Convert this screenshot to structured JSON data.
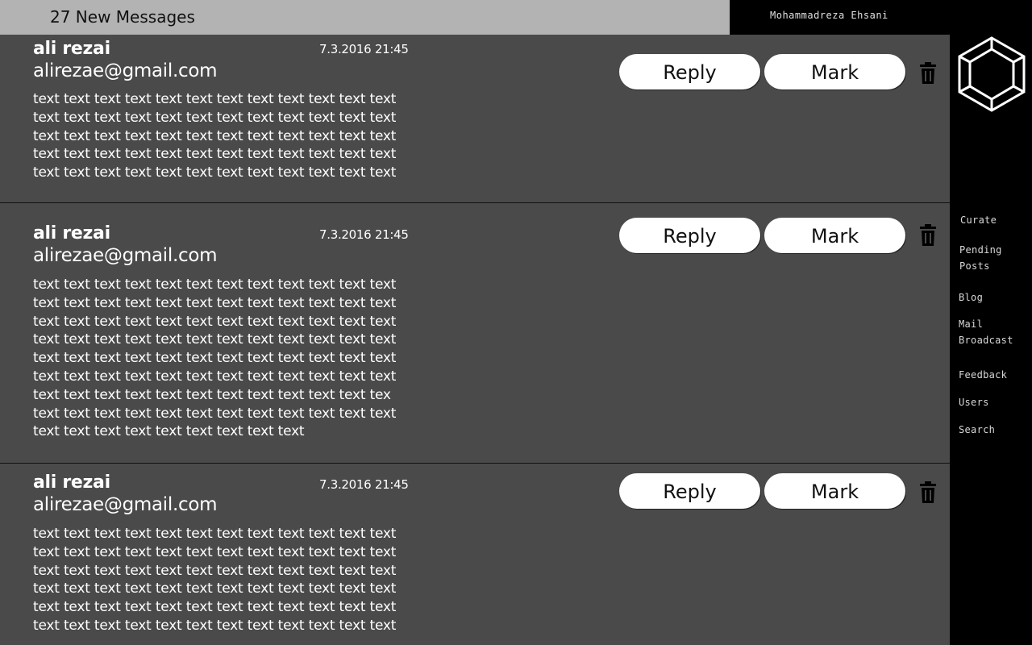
{
  "header": {
    "new_messages": "27 New Messages"
  },
  "user": {
    "name": "Mohammadreza Ehsani"
  },
  "sidebar": {
    "logo": "hexagon-cube-logo",
    "items": [
      {
        "label": "Curate"
      },
      {
        "label": "Pending\nPosts"
      },
      {
        "label": "Blog"
      },
      {
        "label": "Mail\nBroadcast"
      },
      {
        "label": "Feedback"
      },
      {
        "label": "Users"
      },
      {
        "label": "Search"
      }
    ]
  },
  "buttons": {
    "reply": "Reply",
    "mark": "Mark",
    "delete_icon": "trash-icon"
  },
  "messages": [
    {
      "name": "ali rezai",
      "email": "alirezae@gmail.com",
      "date": "7.3.2016 21:45",
      "lines": [
        "text text text text text text text text text text text text",
        "text text text text text text text text text text text text",
        "text text text text text text text text text text text text",
        "text text text text text text text text text text text text",
        "text text text text text text text text text text text text"
      ]
    },
    {
      "name": "ali rezai",
      "email": "alirezae@gmail.com",
      "date": "7.3.2016 21:45",
      "lines": [
        "text text text text text text text text text text text text",
        "text text text text text text text text text text text text",
        "text text text text text text text text text text text text",
        "text text text text text text text text text text text text",
        "text text text text text text text text text text text text",
        "text text text text text text text text text text text text",
        "text text text text text text text text text text text tex",
        "text text text text text text text text text text text text",
        "text text text text text text text text text"
      ]
    },
    {
      "name": "ali rezai",
      "email": "alirezae@gmail.com",
      "date": "7.3.2016 21:45",
      "lines": [
        "text text text text text text text text text text text text",
        "text text text text text text text text text text text text",
        "text text text text text text text text text text text text",
        "text text text text text text text text text text text text",
        "text text text text text text text text text text text text",
        "text text text text text text text text text text text text"
      ]
    }
  ]
}
